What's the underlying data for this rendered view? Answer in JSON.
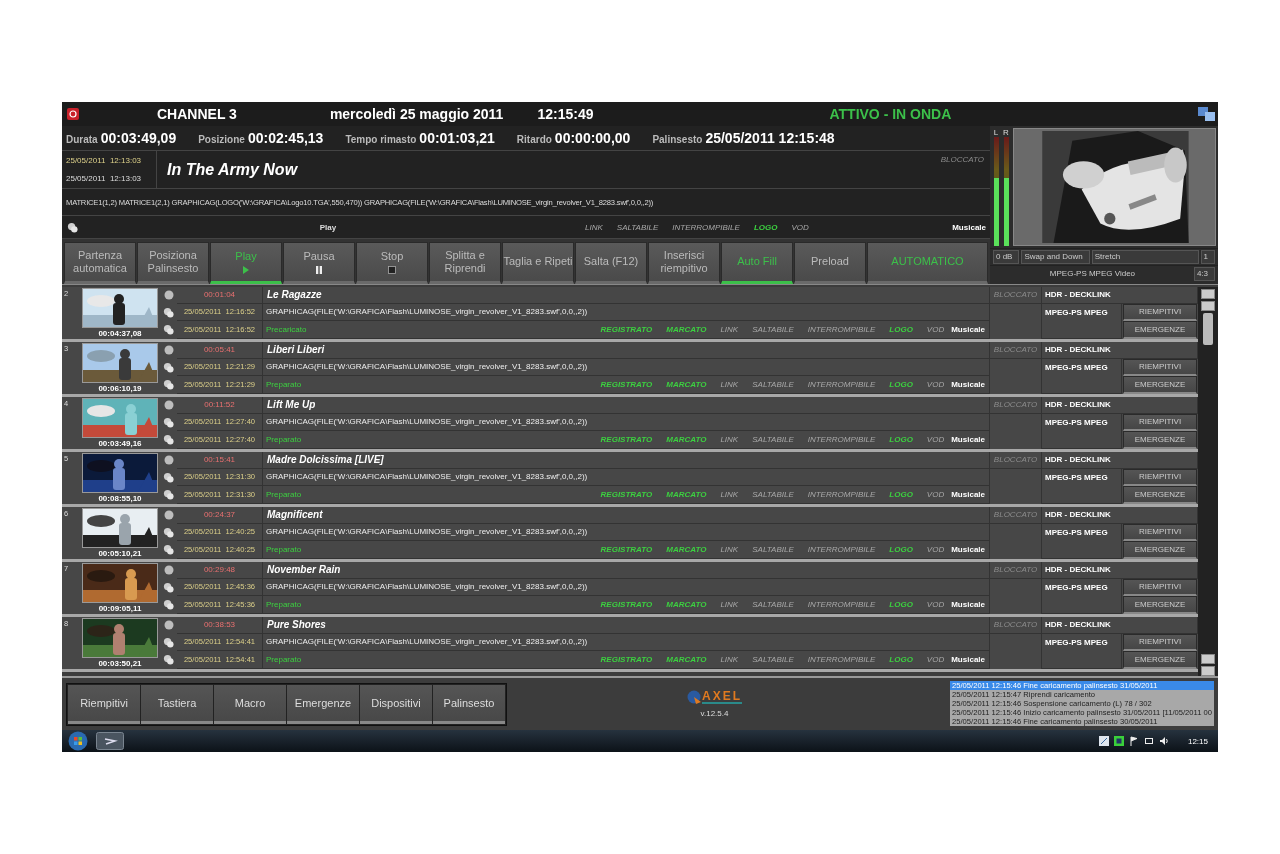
{
  "title_bar": {
    "channel": "CHANNEL 3",
    "date": "mercoledì 25 maggio 2011",
    "time": "12:15:49",
    "status": "ATTIVO - IN ONDA"
  },
  "stats": [
    {
      "label": "Durata",
      "value": "00:03:49,09"
    },
    {
      "label": "Posizione",
      "value": "00:02:45,13"
    },
    {
      "label": "Tempo rimasto",
      "value": "00:01:03,21"
    },
    {
      "label": "Ritardo",
      "value": "00:00:00,00"
    },
    {
      "label": "Palinsesto",
      "value": "25/05/2011  12:15:48"
    }
  ],
  "current": {
    "start": {
      "date": "25/05/2011",
      "time": "12:13:03"
    },
    "end": {
      "date": "25/05/2011",
      "time": "12:13:03"
    },
    "title": "In The Army Now",
    "lock": "BLOCCATO",
    "command": "MATRICE1(1,2) MATRICE1(2,1) GRAPHICAG(LOGO('W:\\GRAFICA\\Logo10.TGA',550,470)) GRAPHICAG(FILE('W:\\GRAFICA\\Flash\\LUMINOSE_virgin_revolver_V1_8283.swf',0,0,,2))",
    "action": "Play",
    "genre": "Musicale",
    "flags": [
      {
        "label": "LINK",
        "on": false
      },
      {
        "label": "SALTABILE",
        "on": false
      },
      {
        "label": "INTERROMPIBILE",
        "on": false
      },
      {
        "label": "LOGO",
        "on": true
      },
      {
        "label": "VOD",
        "on": false
      }
    ]
  },
  "controls": [
    {
      "label": "Partenza automatica",
      "kind": "plain",
      "selected": false
    },
    {
      "label": "Posiziona Palinsesto",
      "kind": "plain",
      "selected": false
    },
    {
      "label": "Play",
      "kind": "play",
      "selected": true
    },
    {
      "label": "Pausa",
      "kind": "pause",
      "selected": false
    },
    {
      "label": "Stop",
      "kind": "stop",
      "selected": false
    },
    {
      "label": "Splitta e Riprendi",
      "kind": "plain",
      "selected": false
    },
    {
      "label": "Taglia e Ripeti",
      "kind": "plain",
      "selected": false
    },
    {
      "label": "Salta (F12)",
      "kind": "plain",
      "selected": false
    },
    {
      "label": "Inserisci riempitivo",
      "kind": "plain",
      "selected": false
    },
    {
      "label": "Auto Fill",
      "kind": "plain",
      "selected": true
    },
    {
      "label": "Preload",
      "kind": "plain",
      "selected": false
    },
    {
      "label": "AUTOMATICO",
      "kind": "mode",
      "selected": false
    }
  ],
  "preview": {
    "meters": [
      {
        "label": "L",
        "level": 0.62
      },
      {
        "label": "R",
        "level": 0.62
      }
    ],
    "audio": "0 dB",
    "transition": "Swap and Down",
    "scaling": "Stretch",
    "layer": "1",
    "format": "MPEG-PS MPEG Video",
    "aspect": "4:3"
  },
  "playlist": [
    {
      "number": "2",
      "duration": "00:04:37,08",
      "offset": "00:01:04",
      "title": "Le Ragazze",
      "start": {
        "date": "25/05/2011",
        "time": "12:16:52"
      },
      "end": {
        "date": "25/05/2011",
        "time": "12:16:52"
      },
      "command": "GRAPHICAG(FILE('W:\\GRAFICA\\Flash\\LUMINOSE_virgin_revolver_V1_8283.swf',0,0,,2))",
      "status": "Precaricato",
      "flags": [
        {
          "label": "REGISTRATO",
          "on": true
        },
        {
          "label": "MARCATO",
          "on": true
        },
        {
          "label": "LINK",
          "on": false
        },
        {
          "label": "SALTABILE",
          "on": false
        },
        {
          "label": "INTERROMPIBILE",
          "on": false
        },
        {
          "label": "LOGO",
          "on": true
        },
        {
          "label": "VOD",
          "on": false
        }
      ],
      "genre": "Musicale",
      "lock": "BLOCCATO",
      "device": "HDR - DECKLINK",
      "format": "MPEG-PS MPEG",
      "buttons": [
        "RIEMPITIVI",
        "EMERGENZE"
      ]
    },
    {
      "number": "3",
      "duration": "00:06:10,19",
      "offset": "00:05:41",
      "title": "Liberi Liberi",
      "start": {
        "date": "25/05/2011",
        "time": "12:21:29"
      },
      "end": {
        "date": "25/05/2011",
        "time": "12:21:29"
      },
      "command": "GRAPHICAG(FILE('W:\\GRAFICA\\Flash\\LUMINOSE_virgin_revolver_V1_8283.swf',0,0,,2))",
      "status": "Preparato",
      "flags": [
        {
          "label": "REGISTRATO",
          "on": true
        },
        {
          "label": "MARCATO",
          "on": true
        },
        {
          "label": "LINK",
          "on": false
        },
        {
          "label": "SALTABILE",
          "on": false
        },
        {
          "label": "INTERROMPIBILE",
          "on": false
        },
        {
          "label": "LOGO",
          "on": true
        },
        {
          "label": "VOD",
          "on": false
        }
      ],
      "genre": "Musicale",
      "lock": "BLOCCATO",
      "device": "HDR - DECKLINK",
      "format": "MPEG-PS MPEG",
      "buttons": [
        "RIEMPITIVI",
        "EMERGENZE"
      ]
    },
    {
      "number": "4",
      "duration": "00:03:49,16",
      "offset": "00:11:52",
      "title": "Lift Me Up",
      "start": {
        "date": "25/05/2011",
        "time": "12:27:40"
      },
      "end": {
        "date": "25/05/2011",
        "time": "12:27:40"
      },
      "command": "GRAPHICAG(FILE('W:\\GRAFICA\\Flash\\LUMINOSE_virgin_revolver_V1_8283.swf',0,0,,2))",
      "status": "Preparato",
      "flags": [
        {
          "label": "REGISTRATO",
          "on": true
        },
        {
          "label": "MARCATO",
          "on": true
        },
        {
          "label": "LINK",
          "on": false
        },
        {
          "label": "SALTABILE",
          "on": false
        },
        {
          "label": "INTERROMPIBILE",
          "on": false
        },
        {
          "label": "LOGO",
          "on": true
        },
        {
          "label": "VOD",
          "on": false
        }
      ],
      "genre": "Musicale",
      "lock": "BLOCCATO",
      "device": "HDR - DECKLINK",
      "format": "MPEG-PS MPEG",
      "buttons": [
        "RIEMPITIVI",
        "EMERGENZE"
      ]
    },
    {
      "number": "5",
      "duration": "00:08:55,10",
      "offset": "00:15:41",
      "title": "Madre Dolcissima [LIVE]",
      "start": {
        "date": "25/05/2011",
        "time": "12:31:30"
      },
      "end": {
        "date": "25/05/2011",
        "time": "12:31:30"
      },
      "command": "GRAPHICAG(FILE('W:\\GRAFICA\\Flash\\LUMINOSE_virgin_revolver_V1_8283.swf',0,0,,2))",
      "status": "Preparato",
      "flags": [
        {
          "label": "REGISTRATO",
          "on": true
        },
        {
          "label": "MARCATO",
          "on": true
        },
        {
          "label": "LINK",
          "on": false
        },
        {
          "label": "SALTABILE",
          "on": false
        },
        {
          "label": "INTERROMPIBILE",
          "on": false
        },
        {
          "label": "LOGO",
          "on": true
        },
        {
          "label": "VOD",
          "on": false
        }
      ],
      "genre": "Musicale",
      "lock": "BLOCCATO",
      "device": "HDR - DECKLINK",
      "format": "MPEG-PS MPEG",
      "buttons": [
        "RIEMPITIVI",
        "EMERGENZE"
      ]
    },
    {
      "number": "6",
      "duration": "00:05:10,21",
      "offset": "00:24:37",
      "title": "Magnificent",
      "start": {
        "date": "25/05/2011",
        "time": "12:40:25"
      },
      "end": {
        "date": "25/05/2011",
        "time": "12:40:25"
      },
      "command": "GRAPHICAG(FILE('W:\\GRAFICA\\Flash\\LUMINOSE_virgin_revolver_V1_8283.swf',0,0,,2))",
      "status": "Preparato",
      "flags": [
        {
          "label": "REGISTRATO",
          "on": true
        },
        {
          "label": "MARCATO",
          "on": true
        },
        {
          "label": "LINK",
          "on": false
        },
        {
          "label": "SALTABILE",
          "on": false
        },
        {
          "label": "INTERROMPIBILE",
          "on": false
        },
        {
          "label": "LOGO",
          "on": true
        },
        {
          "label": "VOD",
          "on": false
        }
      ],
      "genre": "Musicale",
      "lock": "BLOCCATO",
      "device": "HDR - DECKLINK",
      "format": "MPEG-PS MPEG",
      "buttons": [
        "RIEMPITIVI",
        "EMERGENZE"
      ]
    },
    {
      "number": "7",
      "duration": "00:09:05,11",
      "offset": "00:29:48",
      "title": "November Rain",
      "start": {
        "date": "25/05/2011",
        "time": "12:45:36"
      },
      "end": {
        "date": "25/05/2011",
        "time": "12:45:36"
      },
      "command": "GRAPHICAG(FILE('W:\\GRAFICA\\Flash\\LUMINOSE_virgin_revolver_V1_8283.swf',0,0,,2))",
      "status": "Preparato",
      "flags": [
        {
          "label": "REGISTRATO",
          "on": true
        },
        {
          "label": "MARCATO",
          "on": true
        },
        {
          "label": "LINK",
          "on": false
        },
        {
          "label": "SALTABILE",
          "on": false
        },
        {
          "label": "INTERROMPIBILE",
          "on": false
        },
        {
          "label": "LOGO",
          "on": true
        },
        {
          "label": "VOD",
          "on": false
        }
      ],
      "genre": "Musicale",
      "lock": "BLOCCATO",
      "device": "HDR - DECKLINK",
      "format": "MPEG-PS MPEG",
      "buttons": [
        "RIEMPITIVI",
        "EMERGENZE"
      ]
    },
    {
      "number": "8",
      "duration": "00:03:50,21",
      "offset": "00:38:53",
      "title": "Pure Shores",
      "start": {
        "date": "25/05/2011",
        "time": "12:54:41"
      },
      "end": {
        "date": "25/05/2011",
        "time": "12:54:41"
      },
      "command": "GRAPHICAG(FILE('W:\\GRAFICA\\Flash\\LUMINOSE_virgin_revolver_V1_8283.swf',0,0,,2))",
      "status": "Preparato",
      "flags": [
        {
          "label": "REGISTRATO",
          "on": true
        },
        {
          "label": "MARCATO",
          "on": true
        },
        {
          "label": "LINK",
          "on": false
        },
        {
          "label": "SALTABILE",
          "on": false
        },
        {
          "label": "INTERROMPIBILE",
          "on": false
        },
        {
          "label": "LOGO",
          "on": true
        },
        {
          "label": "VOD",
          "on": false
        }
      ],
      "genre": "Musicale",
      "lock": "BLOCCATO",
      "device": "HDR - DECKLINK",
      "format": "MPEG-PS MPEG",
      "buttons": [
        "RIEMPITIVI",
        "EMERGENZE"
      ]
    }
  ],
  "bottom_tabs": [
    "Riempitivi",
    "Tastiera",
    "Macro",
    "Emergenze",
    "Dispositivi",
    "Palinsesto"
  ],
  "logo": {
    "name": "AXEL",
    "version": "v.12.5.4"
  },
  "log": [
    {
      "text": "25/05/2011 12:15:46 Fine caricamento palinsesto 31/05/2011",
      "selected": true
    },
    {
      "text": "25/05/2011 12:15:47 Riprendi caricamento",
      "selected": false
    },
    {
      "text": "25/05/2011 12:15:46 Sospensione caricamento (L) 78 / 302",
      "selected": false
    },
    {
      "text": "25/05/2011 12:15:46 Inizio caricamento palinsesto 31/05/2011 [11/05/2011 00",
      "selected": false
    },
    {
      "text": "25/05/2011 12:15:46 Fine caricamento palinsesto 30/05/2011",
      "selected": false
    }
  ],
  "taskbar": {
    "clock": "12:15"
  }
}
